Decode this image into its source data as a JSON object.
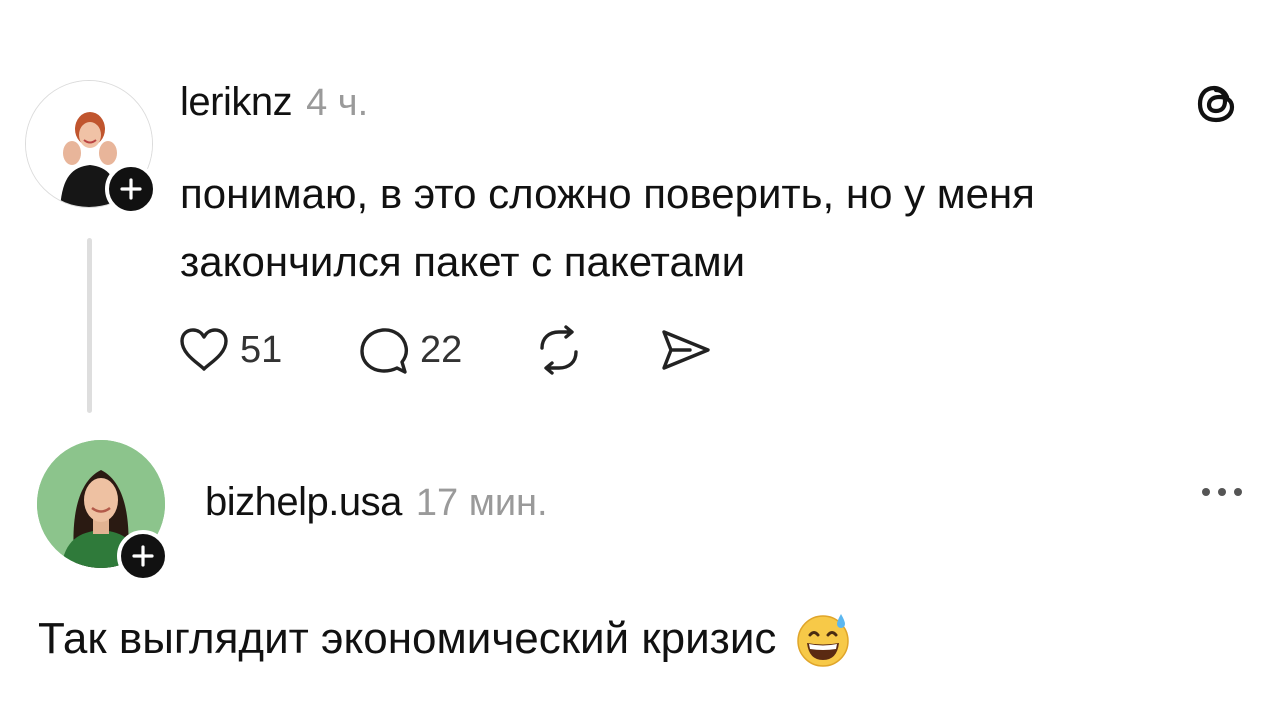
{
  "post1": {
    "username": "leriknz",
    "time": "4 ч.",
    "text": "понимаю, в это сложно поверить, но у меня закончился пакет с пакетами",
    "likes": "51",
    "comments": "22",
    "icons": {
      "like": "heart-icon",
      "comment": "comment-icon",
      "repost": "repost-icon",
      "share": "send-icon",
      "brand": "threads-logo-icon",
      "follow": "plus-icon"
    }
  },
  "post2": {
    "username": "bizhelp.usa",
    "time": "17 мин.",
    "text": "Так выглядит экономический кризис",
    "emoji": "grinning-face-with-sweat-emoji",
    "icons": {
      "more": "more-dots-icon",
      "follow": "plus-icon"
    }
  },
  "colors": {
    "text": "#111111",
    "muted": "#9a9a9a",
    "thread_line": "#dedede",
    "avatar2_bg": "#8cc48c"
  }
}
